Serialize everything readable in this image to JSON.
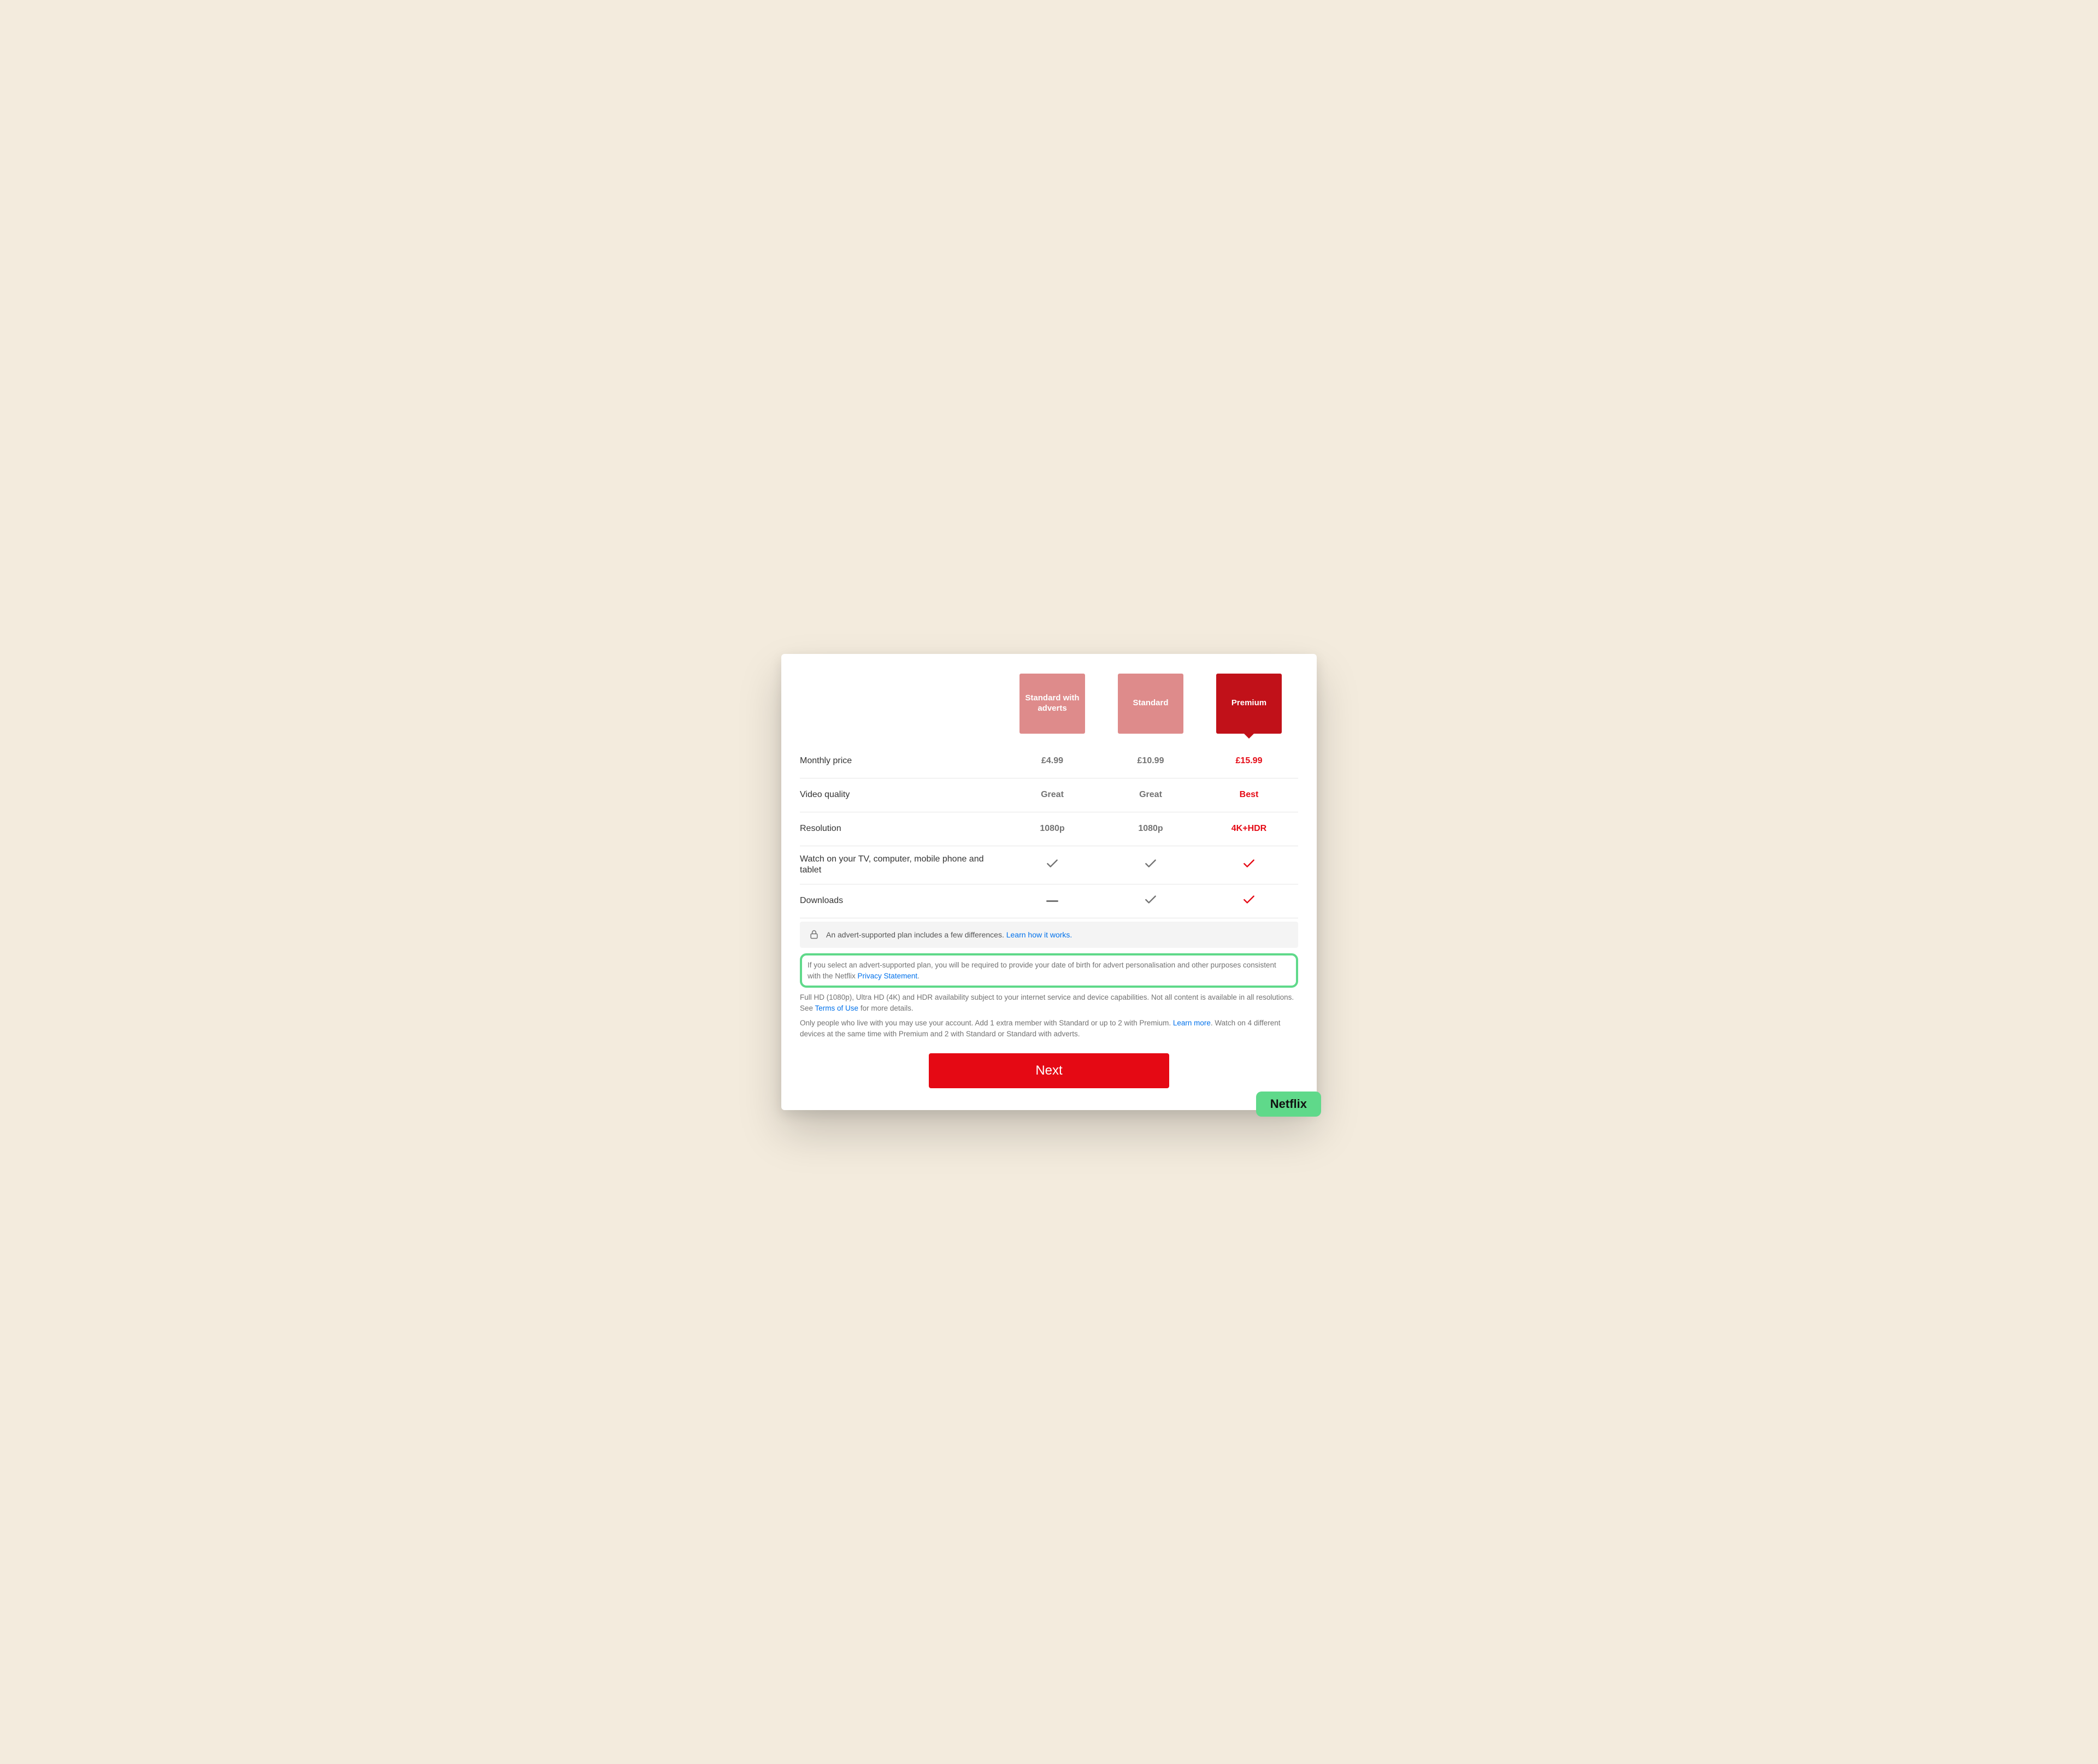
{
  "plans": [
    {
      "name": "Standard with adverts",
      "selected": false
    },
    {
      "name": "Standard",
      "selected": false
    },
    {
      "name": "Premium",
      "selected": true
    }
  ],
  "rows": {
    "price": {
      "label": "Monthly price",
      "cells": [
        "£4.99",
        "£10.99",
        "£15.99"
      ]
    },
    "quality": {
      "label": "Video quality",
      "cells": [
        "Great",
        "Great",
        "Best"
      ]
    },
    "resolution": {
      "label": "Resolution",
      "cells": [
        "1080p",
        "1080p",
        "4K+HDR"
      ]
    },
    "devices": {
      "label": "Watch on your TV, computer, mobile phone and tablet",
      "cells": [
        "check",
        "check",
        "check"
      ]
    },
    "downloads": {
      "label": "Downloads",
      "cells": [
        "dash",
        "check",
        "check"
      ]
    }
  },
  "info": {
    "text": "An advert-supported plan includes a few differences.",
    "link": "Learn how it works."
  },
  "highlight": {
    "pre": "If you select an advert-supported plan, you will be required to provide your date of birth for advert personalisation and other purposes consistent with the Netflix ",
    "link": "Privacy Statement",
    "post": "."
  },
  "disclaimer1": {
    "pre": "Full HD (1080p), Ultra HD (4K) and HDR availability subject to your internet service and device capabilities. Not all content is available in all resolutions. See ",
    "link": "Terms of Use",
    "post": " for more details."
  },
  "disclaimer2": {
    "pre": "Only people who live with you may use your account. Add 1 extra member with Standard or up to 2 with Premium. ",
    "link": "Learn more",
    "post": ". Watch on 4 different devices at the same time with Premium and 2 with Standard or Standard with adverts."
  },
  "nextLabel": "Next",
  "badge": "Netflix"
}
